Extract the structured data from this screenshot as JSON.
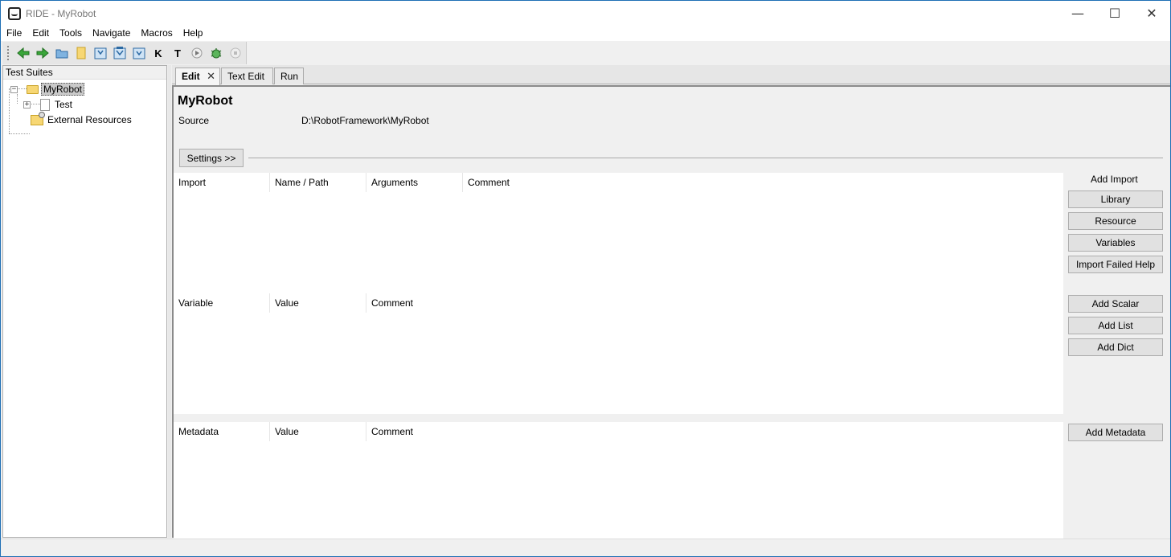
{
  "window": {
    "title": "RIDE - MyRobot",
    "minimize": "—",
    "maximize": "☐",
    "close": "✕"
  },
  "menu": [
    "File",
    "Edit",
    "Tools",
    "Navigate",
    "Macros",
    "Help"
  ],
  "toolbar": {
    "icons": [
      "back-arrow-icon",
      "forward-arrow-icon",
      "open-folder-icon",
      "new-file-icon",
      "save-icon",
      "save-all-icon",
      "save-as-icon",
      "keyword-search-icon",
      "test-search-icon",
      "run-icon",
      "debug-bug-icon",
      "stop-icon"
    ],
    "k_label": "K",
    "t_label": "T"
  },
  "left_pane": {
    "header": "Test Suites",
    "tree": [
      {
        "label": "MyRobot",
        "selected": true
      },
      {
        "label": "Test"
      },
      {
        "label": "External Resources"
      }
    ]
  },
  "tabs": [
    {
      "label": "Edit",
      "active": true
    },
    {
      "label": "Text Edit"
    },
    {
      "label": "Run"
    }
  ],
  "editor": {
    "title": "MyRobot",
    "source_label": "Source",
    "source_value": "D:\\RobotFramework\\MyRobot",
    "settings_button": "Settings >>",
    "import_table": {
      "headers": [
        "Import",
        "Name / Path",
        "Arguments",
        "Comment"
      ]
    },
    "variable_table": {
      "headers": [
        "Variable",
        "Value",
        "Comment"
      ]
    },
    "metadata_table": {
      "headers": [
        "Metadata",
        "Value",
        "Comment"
      ]
    },
    "add_import_label": "Add Import",
    "import_buttons": [
      "Library",
      "Resource",
      "Variables",
      "Import Failed Help"
    ],
    "variable_buttons": [
      "Add Scalar",
      "Add List",
      "Add Dict"
    ],
    "metadata_button": "Add Metadata"
  }
}
